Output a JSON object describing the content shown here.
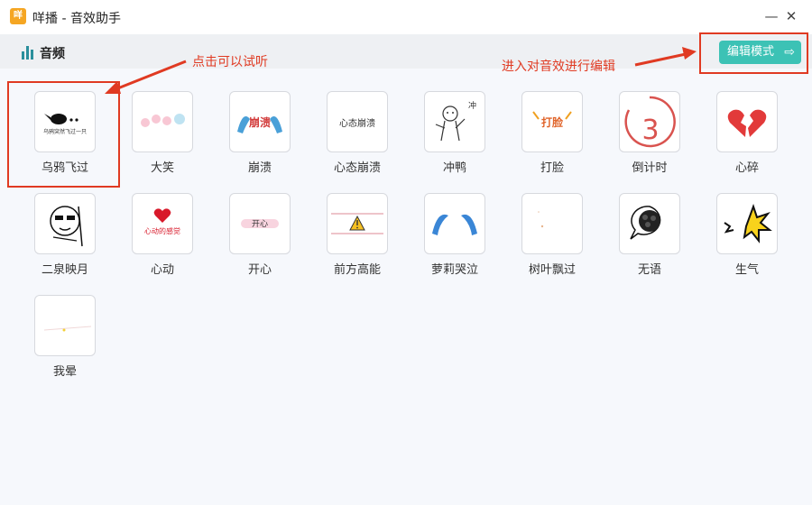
{
  "window": {
    "logo_text": "咩",
    "title": "咩播 - 音效助手",
    "minimize_glyph": "—",
    "close_glyph": "✕"
  },
  "header": {
    "title": "音频",
    "edit_button": "编辑模式",
    "edit_arrow": "⇨"
  },
  "annotations": {
    "click_to_listen": "点击可以试听",
    "enter_edit": "进入对音效进行编辑"
  },
  "sounds": [
    {
      "label": "乌鸦飞过",
      "thumb_text": "乌鸦突然飞过一只"
    },
    {
      "label": "大笑",
      "thumb_text": ""
    },
    {
      "label": "崩溃",
      "thumb_text": "崩溃"
    },
    {
      "label": "心态崩溃",
      "thumb_text": "心态崩溃"
    },
    {
      "label": "冲鸭",
      "thumb_text": "冲"
    },
    {
      "label": "打脸",
      "thumb_text": "打脸"
    },
    {
      "label": "倒计时",
      "thumb_text": "3"
    },
    {
      "label": "心碎",
      "thumb_text": ""
    },
    {
      "label": "二泉映月",
      "thumb_text": ""
    },
    {
      "label": "心动",
      "thumb_text": "心动的感觉"
    },
    {
      "label": "开心",
      "thumb_text": "开心"
    },
    {
      "label": "前方高能",
      "thumb_text": ""
    },
    {
      "label": "萝莉哭泣",
      "thumb_text": ""
    },
    {
      "label": "树叶飘过",
      "thumb_text": ""
    },
    {
      "label": "无语",
      "thumb_text": ""
    },
    {
      "label": "生气",
      "thumb_text": ""
    },
    {
      "label": "我晕",
      "thumb_text": ""
    }
  ],
  "colors": {
    "accent": "#3cc2b5",
    "annotation": "#e03a22",
    "header_bg": "#eef0f3",
    "content_bg": "#f6f8fc"
  }
}
